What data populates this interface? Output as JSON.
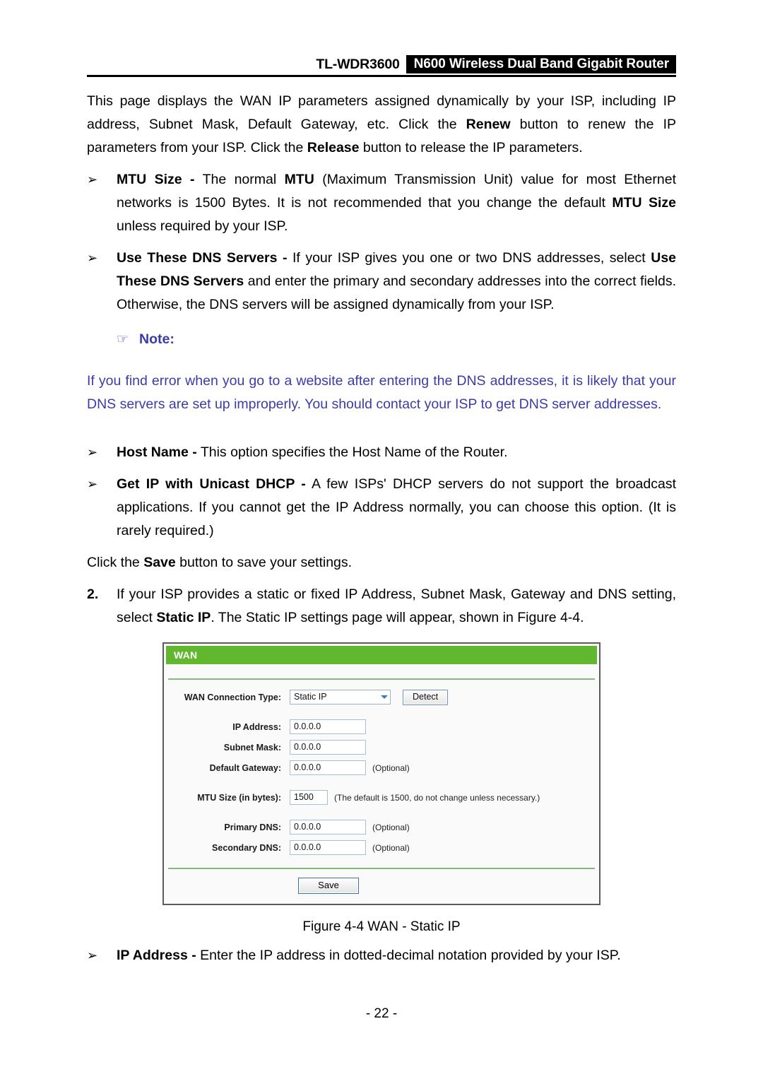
{
  "header": {
    "model": "TL-WDR3600",
    "product": "N600 Wireless Dual Band Gigabit Router"
  },
  "intro": {
    "t1": "This page displays the WAN IP parameters assigned dynamically by your ISP, including IP address, Subnet Mask, Default Gateway, etc. Click the ",
    "b1": "Renew",
    "t2": " button to renew the IP parameters from your ISP. Click the ",
    "b2": "Release",
    "t3": " button to release the IP parameters."
  },
  "bullets": {
    "bullet_glyph": "➢",
    "mtu": {
      "term": "MTU Size -",
      "t1": " The normal ",
      "b1": "MTU",
      "t2": " (Maximum Transmission Unit) value for most Ethernet networks is 1500 Bytes. It is not recommended that you change the default ",
      "b2": "MTU Size",
      "t3": " unless required by your ISP."
    },
    "dns": {
      "term": "Use These DNS Servers -",
      "t1": " If your ISP gives you one or two DNS addresses, select ",
      "b1": "Use These DNS Servers",
      "t2": " and enter the primary and secondary addresses into the correct fields. Otherwise, the DNS servers will be assigned dynamically from your ISP."
    },
    "hostname": {
      "term": "Host Name -",
      "t1": " This option specifies the Host Name of the Router."
    },
    "unicast": {
      "term": "Get IP with Unicast DHCP -",
      "t1": " A few ISPs' DHCP servers do not support the broadcast applications. If you cannot get the IP Address normally, you can choose this option. (It is rarely required.)"
    },
    "ipaddress": {
      "term": "IP Address -",
      "t1": " Enter the IP address in dotted-decimal notation provided by your ISP."
    }
  },
  "note": {
    "icon_glyph": "☞",
    "title": "Note:",
    "body": "If you find error when you go to a website after entering the DNS addresses, it is likely that your DNS servers are set up improperly. You should contact your ISP to get DNS server addresses.",
    "color": "#3B3BA8"
  },
  "save_line": {
    "t1": "Click the ",
    "b1": "Save",
    "t2": " button to save your settings."
  },
  "step2": {
    "number": "2.",
    "t1": "If your ISP provides a static or fixed IP Address, Subnet Mask, Gateway and DNS setting, select ",
    "b1": "Static IP",
    "t2": ". The Static IP settings page will appear, shown in Figure 4-4."
  },
  "router_ui": {
    "panel_title": "WAN",
    "accent_green": "#61b72e",
    "connection_type": {
      "label": "WAN Connection Type:",
      "value": "Static IP",
      "detect_label": "Detect"
    },
    "fields": [
      {
        "label": "IP Address:",
        "value": "0.0.0.0",
        "hint": ""
      },
      {
        "label": "Subnet Mask:",
        "value": "0.0.0.0",
        "hint": ""
      },
      {
        "label": "Default Gateway:",
        "value": "0.0.0.0",
        "hint": "(Optional)"
      }
    ],
    "mtu": {
      "label": "MTU Size (in bytes):",
      "value": "1500",
      "hint": "(The default is 1500, do not change unless necessary.)"
    },
    "dns_fields": [
      {
        "label": "Primary DNS:",
        "value": "0.0.0.0",
        "hint": "(Optional)"
      },
      {
        "label": "Secondary DNS:",
        "value": "0.0.0.0",
        "hint": "(Optional)"
      }
    ],
    "save_label": "Save"
  },
  "figure_caption": "Figure 4-4 WAN - Static IP",
  "footer": {
    "page_number": "- 22 -"
  }
}
